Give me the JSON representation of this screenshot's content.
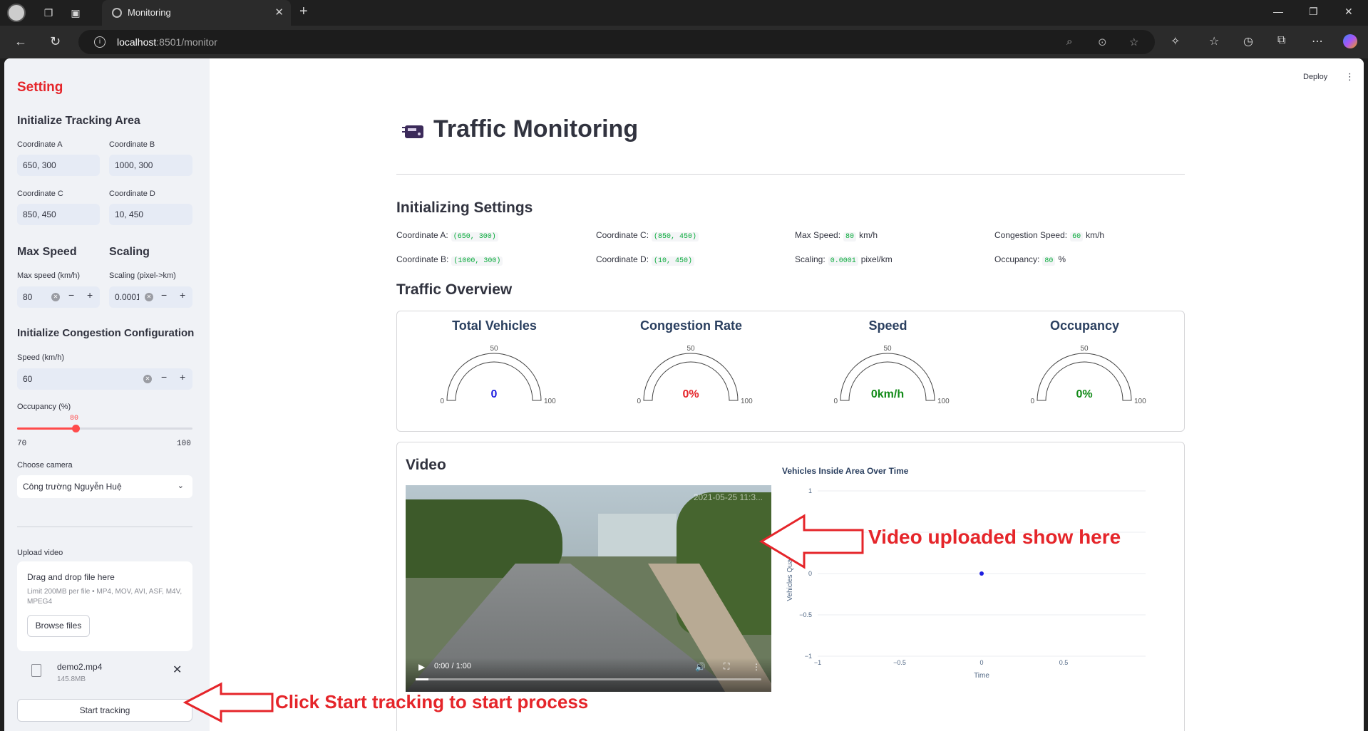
{
  "browser": {
    "tab_title": "Monitoring",
    "url_host": "localhost",
    "url_rest": ":8501/monitor",
    "new_tab_glyph": "+",
    "close_glyph": "✕"
  },
  "header": {
    "deploy_label": "Deploy"
  },
  "sidebar": {
    "title": "Setting",
    "tracking_area": {
      "heading": "Initialize Tracking Area",
      "coord_a": {
        "label": "Coordinate A",
        "value": "650, 300"
      },
      "coord_b": {
        "label": "Coordinate B",
        "value": "1000, 300"
      },
      "coord_c": {
        "label": "Coordinate C",
        "value": "850, 450"
      },
      "coord_d": {
        "label": "Coordinate D",
        "value": "10, 450"
      }
    },
    "max_speed": {
      "heading": "Max Speed",
      "label": "Max speed (km/h)",
      "value": "80"
    },
    "scaling": {
      "heading": "Scaling",
      "label": "Scaling (pixel->km)",
      "value": "0.0001"
    },
    "congestion": {
      "heading": "Initialize Congestion Configuration",
      "speed_label": "Speed (km/h)",
      "speed_value": "60",
      "occupancy_label": "Occupancy (%)",
      "occupancy_value": "80",
      "occupancy_min": "70",
      "occupancy_max": "100"
    },
    "camera": {
      "label": "Choose camera",
      "selected": "Công trường Nguyễn Huệ"
    },
    "upload": {
      "label": "Upload video",
      "drop_title": "Drag and drop file here",
      "hint": "Limit 200MB per file • MP4, MOV, AVI, ASF, M4V, MPEG4",
      "browse_label": "Browse files",
      "file_name": "demo2.mp4",
      "file_size": "145.8MB"
    },
    "start_label": "Start tracking"
  },
  "main": {
    "page_title": "Traffic Monitoring",
    "settings": {
      "heading": "Initializing Settings",
      "coord_a_label": "Coordinate A:",
      "coord_a": "(650, 300)",
      "coord_b_label": "Coordinate B:",
      "coord_b": "(1000, 300)",
      "coord_c_label": "Coordinate C:",
      "coord_c": "(850, 450)",
      "coord_d_label": "Coordinate D:",
      "coord_d": "(10, 450)",
      "max_speed_label": "Max Speed:",
      "max_speed": "80",
      "max_speed_unit": "km/h",
      "scaling_label": "Scaling:",
      "scaling": "0.0001",
      "scaling_unit": "pixel/km",
      "cong_speed_label": "Congestion Speed:",
      "cong_speed": "60",
      "cong_speed_unit": "km/h",
      "occupancy_label": "Occupancy:",
      "occupancy": "80",
      "occupancy_unit": "%"
    },
    "overview": {
      "heading": "Traffic Overview",
      "gauges": [
        {
          "title": "Total Vehicles",
          "value": "0",
          "color": "#1f1fe0",
          "min": "0",
          "mid": "50",
          "max": "100"
        },
        {
          "title": "Congestion Rate",
          "value": "0%",
          "color": "#e5252a",
          "min": "0",
          "mid": "50",
          "max": "100"
        },
        {
          "title": "Speed",
          "value": "0km/h",
          "color": "#118a17",
          "min": "0",
          "mid": "50",
          "max": "100"
        },
        {
          "title": "Occupancy",
          "value": "0%",
          "color": "#118a17",
          "min": "0",
          "mid": "50",
          "max": "100"
        }
      ]
    },
    "video": {
      "heading": "Video",
      "timestamp": "2021-05-25 11:3...",
      "time": "0:00 / 1:00"
    }
  },
  "annotations": {
    "video_note": "Video uploaded show here",
    "start_note": "Click Start tracking to start process"
  },
  "chart_data": {
    "type": "scatter",
    "title": "Vehicles Inside Area Over Time",
    "xlabel": "Time",
    "ylabel": "Vehicles Quantity",
    "xlim": [
      -1,
      1
    ],
    "ylim": [
      -1,
      1
    ],
    "xticks": [
      "−1",
      "−0.5",
      "0",
      "0.5"
    ],
    "yticks": [
      "1",
      "0.5",
      "0",
      "−0.5",
      "−1"
    ],
    "x": [
      0
    ],
    "y": [
      0
    ],
    "color": "#1f1fe0"
  }
}
